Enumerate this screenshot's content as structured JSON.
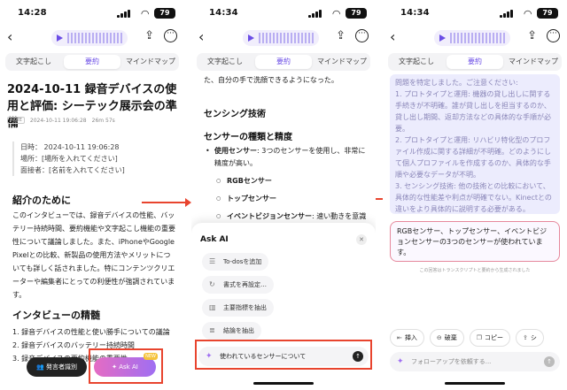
{
  "colors": {
    "accent": "#6b4de6",
    "highlight_box": "#e8442e",
    "answer_bg": "#ececfd",
    "bubble_border": "#e6889c"
  },
  "phones": [
    {
      "status": {
        "time": "14:28",
        "battery": "79"
      },
      "tabs": [
        "文字起こし",
        "要約",
        "マインドマップ"
      ],
      "title": "2024-10-11 録音デバイスの使用と評価: シーテック展示会の準備",
      "meta": {
        "tag": "NOTE",
        "date": "2024-10-11 19:06:28",
        "duration": "26m 57s"
      },
      "info": [
        "日時： 2024-10-11 19:06:28",
        "場所：[場所を入れてください]",
        "面接者：[名前を入れてください]"
      ],
      "section1_title": "紹介のために",
      "section1_text": "このインタビューでは、録音デバイスの性能、バッテリー持続時間、要約機能や文字起こし機能の重要性について議論しました。また、iPhoneやGoogle Pixelとの比較、新製品の使用方法やメリットについても詳しく話されました。特にコンテンツクリエーターや編集者にとっての利便性が強調されています。",
      "section2_title": "インタビューの精髄",
      "list": [
        "1. 録音デバイスの性能と使い勝手についての議論",
        "2. 録音デバイスのバッテリー持続時間",
        "3. 録音デバイスの要約機能の重要性"
      ],
      "speaker_button": "発言者識別",
      "askai_button": "Ask AI",
      "beta": "NEW"
    },
    {
      "status": {
        "time": "14:34",
        "battery": "79"
      },
      "tabs": [
        "文字起こし",
        "要約",
        "マインドマップ"
      ],
      "top_text": "た、自分の手で洗顔できるようになった。",
      "heading1": "センシング技術",
      "heading2": "センサーの種類と精度",
      "bullet_lead": "使用センサー",
      "bullet_text": ": 3つのセンサーを使用し、非常に精度が高い。",
      "sub1": "RGBセンサー",
      "sub2": "トップセンサー",
      "sub3_lead": "イベントビジョンセンサー",
      "sub3_text": ": 速い動きを意識するセンサー。",
      "sheet_title": "Ask AI",
      "suggestions": [
        "To-dosを追加",
        "書式を再設定…",
        "主要指標を抽出",
        "結論を抽出"
      ],
      "prompt": "使われているセンサーについて"
    },
    {
      "status": {
        "time": "14:34",
        "battery": "79"
      },
      "tabs": [
        "文字起こし",
        "要約",
        "マインドマップ"
      ],
      "answer": "問題を特定しました。ご注意ください:\n1. プロトタイプと運用: 機器の貸し出しに関する手続きが不明確。誰が貸し出しを担当するのか、貸し出し期間、返却方法などの具体的な手順が必要。\n2. プロトタイプと運用: リハビリ特化型のプロファイル作成に関する詳細が不明確。どのようにして個人プロファイルを作成するのか、具体的な手順や必要なデータが不明。\n3. センシング技術: 他の技術との比較において、具体的な性能差や利点が明確でない。Kinectとの違いをより具体的に説明する必要がある。",
      "reply": "RGBセンサー、トップセンサー、イベントビジョンセンサーの3つのセンサーが使われています。",
      "disclaimer": "この回答はトランスクリプトと要約から生成されました",
      "actions": [
        "挿入",
        "破棄",
        "コピー",
        "シ"
      ],
      "followup_placeholder": "フォローアップを依頼する..."
    }
  ]
}
